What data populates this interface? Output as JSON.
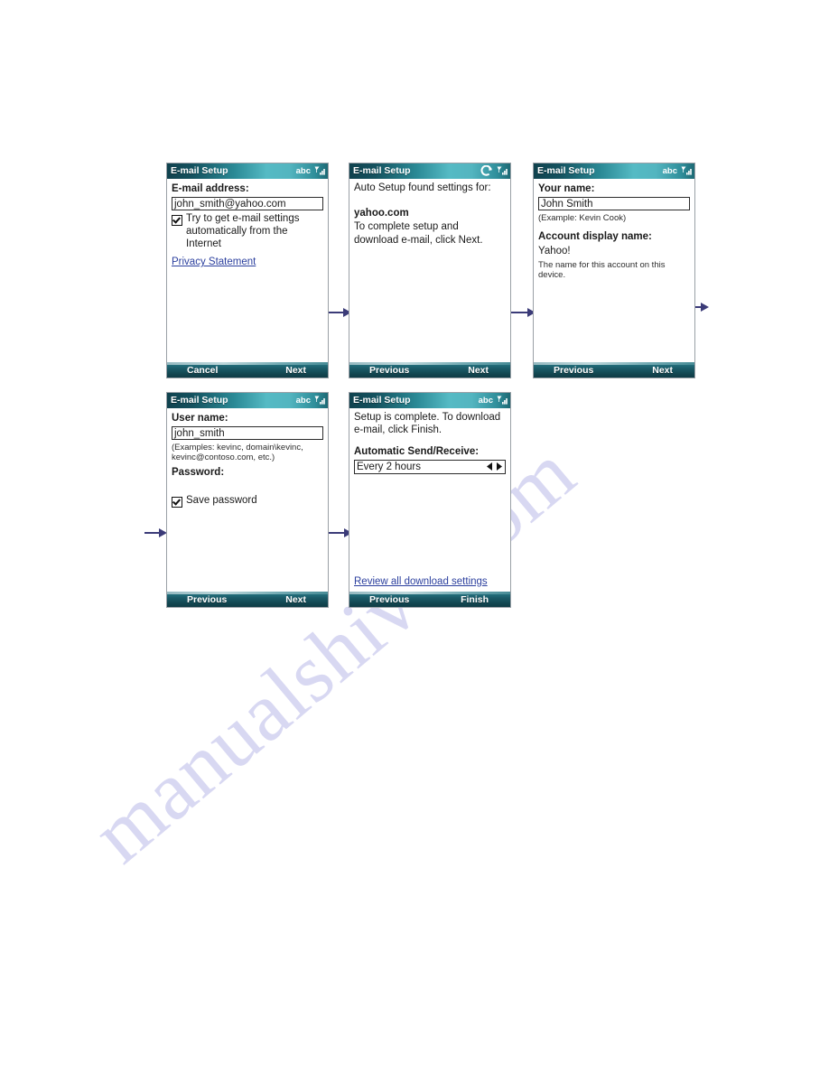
{
  "watermark": {
    "text": "manualshive.com"
  },
  "panels": [
    {
      "id": "panel-email-address",
      "title": "E-mail Setup",
      "status_icons": [
        "abc-indicator",
        "signal-strength-icon"
      ],
      "fields": {
        "label": "E-mail address:",
        "value": "john_smith@yahoo.com",
        "checkbox_label": "Try to get e-mail settings automatically from the Internet",
        "link": "Privacy Statement"
      },
      "softkeys": {
        "left": "Cancel",
        "right": "Next"
      }
    },
    {
      "id": "panel-auto-setup",
      "title": "E-mail Setup",
      "status_icons": [
        "sync-icon",
        "signal-strength-icon"
      ],
      "fields": {
        "intro": "Auto Setup found settings for:",
        "domain": "yahoo.com",
        "instruction": "To complete setup and download e-mail, click Next."
      },
      "softkeys": {
        "left": "Previous",
        "right": "Next"
      }
    },
    {
      "id": "panel-your-name",
      "title": "E-mail Setup",
      "status_icons": [
        "abc-indicator",
        "signal-strength-icon"
      ],
      "fields": {
        "label": "Your name:",
        "value": "John Smith",
        "hint": "(Example: Kevin Cook)",
        "label2": "Account display name:",
        "value2": "Yahoo!",
        "hint2": "The name for this account on this device."
      },
      "softkeys": {
        "left": "Previous",
        "right": "Next"
      }
    },
    {
      "id": "panel-user-name",
      "title": "E-mail Setup",
      "status_icons": [
        "abc-indicator",
        "signal-strength-icon"
      ],
      "fields": {
        "label": "User name:",
        "value": "john_smith",
        "hint": "(Examples: kevinc, domain\\kevinc, kevinc@contoso.com, etc.)",
        "label2": "Password:",
        "checkbox_label": "Save password"
      },
      "softkeys": {
        "left": "Previous",
        "right": "Next"
      }
    },
    {
      "id": "panel-setup-complete",
      "title": "E-mail Setup",
      "status_icons": [
        "abc-indicator",
        "signal-strength-icon"
      ],
      "fields": {
        "intro": "Setup is complete.  To download e-mail, click Finish.",
        "label": "Automatic Send/Receive:",
        "value": "Every 2 hours",
        "link": "Review all download settings"
      },
      "softkeys": {
        "left": "Previous",
        "right": "Finish"
      }
    }
  ],
  "colors": {
    "title_dark": "#10424e",
    "title_light": "#55bac4",
    "softbar": "#134751",
    "link": "#2b3f9e",
    "arrow": "#3b3b78",
    "watermark": "#d8d8f2"
  }
}
